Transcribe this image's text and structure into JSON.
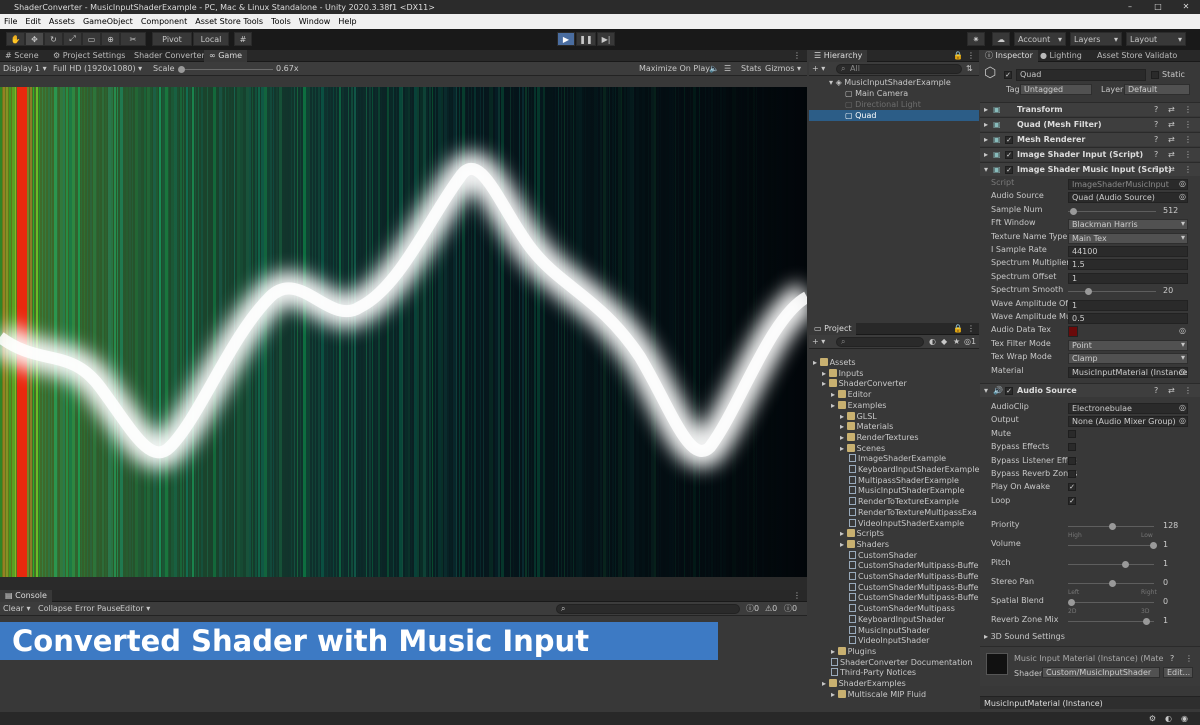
{
  "window": {
    "title": "ShaderConverter - MusicInputShaderExample - PC, Mac & Linux Standalone - Unity 2020.3.38f1 <DX11>"
  },
  "menu": [
    "File",
    "Edit",
    "Assets",
    "GameObject",
    "Component",
    "Asset Store Tools",
    "Tools",
    "Window",
    "Help"
  ],
  "toolbar": {
    "pivot": "Pivot",
    "local": "Local",
    "account": "Account",
    "layers": "Layers",
    "layout": "Layout"
  },
  "left_tabs": [
    "Scene",
    "Project Settings",
    "Shader Converter",
    "Game"
  ],
  "game": {
    "display": "Display 1",
    "resolution": "Full HD (1920x1080)",
    "scale_label": "Scale",
    "scale_value": "0.67x",
    "maximize": "Maximize On Play",
    "stats": "Stats",
    "gizmos": "Gizmos"
  },
  "console": {
    "tab": "Console",
    "clear": "Clear",
    "collapse": "Collapse",
    "error_pause": "Error Pause",
    "editor": "Editor",
    "c1": "0",
    "c2": "0",
    "c3": "0"
  },
  "banner": "Converted Shader with Music Input",
  "hierarchy": {
    "tab": "Hierarchy",
    "search": "All",
    "scene": "MusicInputShaderExample",
    "items": [
      "Main Camera",
      "Directional Light",
      "Quad"
    ]
  },
  "project": {
    "tab": "Project",
    "hidden_count": "1",
    "items": [
      {
        "t": "Assets",
        "d": 0,
        "f": 1
      },
      {
        "t": "Inputs",
        "d": 1,
        "f": 1
      },
      {
        "t": "ShaderConverter",
        "d": 1,
        "f": 1
      },
      {
        "t": "Editor",
        "d": 2,
        "f": 1
      },
      {
        "t": "Examples",
        "d": 2,
        "f": 1
      },
      {
        "t": "GLSL",
        "d": 3,
        "f": 1
      },
      {
        "t": "Materials",
        "d": 3,
        "f": 1
      },
      {
        "t": "RenderTextures",
        "d": 3,
        "f": 1
      },
      {
        "t": "Scenes",
        "d": 3,
        "f": 1
      },
      {
        "t": "ImageShaderExample",
        "d": 4,
        "f": 0
      },
      {
        "t": "KeyboardInputShaderExample",
        "d": 4,
        "f": 0
      },
      {
        "t": "MultipassShaderExample",
        "d": 4,
        "f": 0
      },
      {
        "t": "MusicInputShaderExample",
        "d": 4,
        "f": 0
      },
      {
        "t": "RenderToTextureExample",
        "d": 4,
        "f": 0
      },
      {
        "t": "RenderToTextureMultipassExa",
        "d": 4,
        "f": 0
      },
      {
        "t": "VideoInputShaderExample",
        "d": 4,
        "f": 0
      },
      {
        "t": "Scripts",
        "d": 3,
        "f": 1
      },
      {
        "t": "Shaders",
        "d": 3,
        "f": 1
      },
      {
        "t": "CustomShader",
        "d": 4,
        "f": 0
      },
      {
        "t": "CustomShaderMultipass-Buffe",
        "d": 4,
        "f": 0
      },
      {
        "t": "CustomShaderMultipass-Buffe",
        "d": 4,
        "f": 0
      },
      {
        "t": "CustomShaderMultipass-Buffe",
        "d": 4,
        "f": 0
      },
      {
        "t": "CustomShaderMultipass-Buffe",
        "d": 4,
        "f": 0
      },
      {
        "t": "CustomShaderMultipass",
        "d": 4,
        "f": 0
      },
      {
        "t": "KeyboardInputShader",
        "d": 4,
        "f": 0
      },
      {
        "t": "MusicInputShader",
        "d": 4,
        "f": 0
      },
      {
        "t": "VideoInputShader",
        "d": 4,
        "f": 0
      },
      {
        "t": "Plugins",
        "d": 2,
        "f": 1
      },
      {
        "t": "ShaderConverter Documentation",
        "d": 2,
        "f": 0
      },
      {
        "t": "Third-Party Notices",
        "d": 2,
        "f": 0
      },
      {
        "t": "ShaderExamples",
        "d": 1,
        "f": 1
      },
      {
        "t": "Multiscale MIP Fluid",
        "d": 2,
        "f": 1
      }
    ]
  },
  "inspector": {
    "tabs": [
      "Inspector",
      "Lighting",
      "Asset Store Validato"
    ],
    "name": "Quad",
    "static": "Static",
    "tag_label": "Tag",
    "tag": "Untagged",
    "layer_label": "Layer",
    "layer": "Default",
    "components": [
      "Transform",
      "Quad (Mesh Filter)",
      "Mesh Renderer",
      "Image Shader Input (Script)",
      "Image Shader Music Input (Script)"
    ],
    "music_fields": [
      {
        "l": "Script",
        "v": "ImageShaderMusicInput",
        "k": "obj"
      },
      {
        "l": "Audio Source",
        "v": "Quad (Audio Source)",
        "k": "obj"
      },
      {
        "l": "Sample Num",
        "v": "512",
        "k": "slider",
        "p": 0.02
      },
      {
        "l": "Fft Window",
        "v": "Blackman Harris",
        "k": "drop"
      },
      {
        "l": "Texture Name Type",
        "v": "Main Tex",
        "k": "drop"
      },
      {
        "l": "I Sample Rate",
        "v": "44100",
        "k": "field"
      },
      {
        "l": "Spectrum Multiplier",
        "v": "1.5",
        "k": "field"
      },
      {
        "l": "Spectrum Offset",
        "v": "1",
        "k": "field"
      },
      {
        "l": "Spectrum Smooth",
        "v": "20",
        "k": "slider",
        "p": 0.2
      },
      {
        "l": "Wave Amplitude Offse",
        "v": "1",
        "k": "field"
      },
      {
        "l": "Wave Amplitude Mult",
        "v": "0.5",
        "k": "field"
      },
      {
        "l": "Audio Data Tex",
        "v": "",
        "k": "tex"
      },
      {
        "l": "Tex Filter Mode",
        "v": "Point",
        "k": "drop"
      },
      {
        "l": "Tex Wrap Mode",
        "v": "Clamp",
        "k": "drop"
      },
      {
        "l": "Material",
        "v": "MusicInputMaterial (Instance",
        "k": "obj"
      }
    ],
    "audio_source": "Audio Source",
    "audio_fields": [
      {
        "l": "AudioClip",
        "v": "Electronebulae",
        "k": "obj"
      },
      {
        "l": "Output",
        "v": "None (Audio Mixer Group)",
        "k": "obj"
      },
      {
        "l": "Mute",
        "v": "",
        "k": "check"
      },
      {
        "l": "Bypass Effects",
        "v": "",
        "k": "check"
      },
      {
        "l": "Bypass Listener Effec",
        "v": "",
        "k": "check"
      },
      {
        "l": "Bypass Reverb Zones",
        "v": "",
        "k": "check"
      },
      {
        "l": "Play On Awake",
        "v": "✓",
        "k": "check"
      },
      {
        "l": "Loop",
        "v": "✓",
        "k": "check"
      }
    ],
    "audio_sliders": [
      {
        "l": "Priority",
        "v": "128",
        "p": 0.5,
        "lo": "High",
        "hi": "Low"
      },
      {
        "l": "Volume",
        "v": "1",
        "p": 1
      },
      {
        "l": "Pitch",
        "v": "1",
        "p": 0.66
      },
      {
        "l": "Stereo Pan",
        "v": "0",
        "p": 0.5,
        "lo": "Left",
        "hi": "Right"
      },
      {
        "l": "Spatial Blend",
        "v": "0",
        "p": 0,
        "lo": "2D",
        "hi": "3D"
      },
      {
        "l": "Reverb Zone Mix",
        "v": "1",
        "p": 0.91
      }
    ],
    "sound3d": "3D Sound Settings",
    "material_name": "Music Input Material (Instance) (Mate",
    "shader_label": "Shader",
    "shader": "Custom/MusicInputShader",
    "edit": "Edit...",
    "footer": "MusicInputMaterial (Instance)"
  }
}
